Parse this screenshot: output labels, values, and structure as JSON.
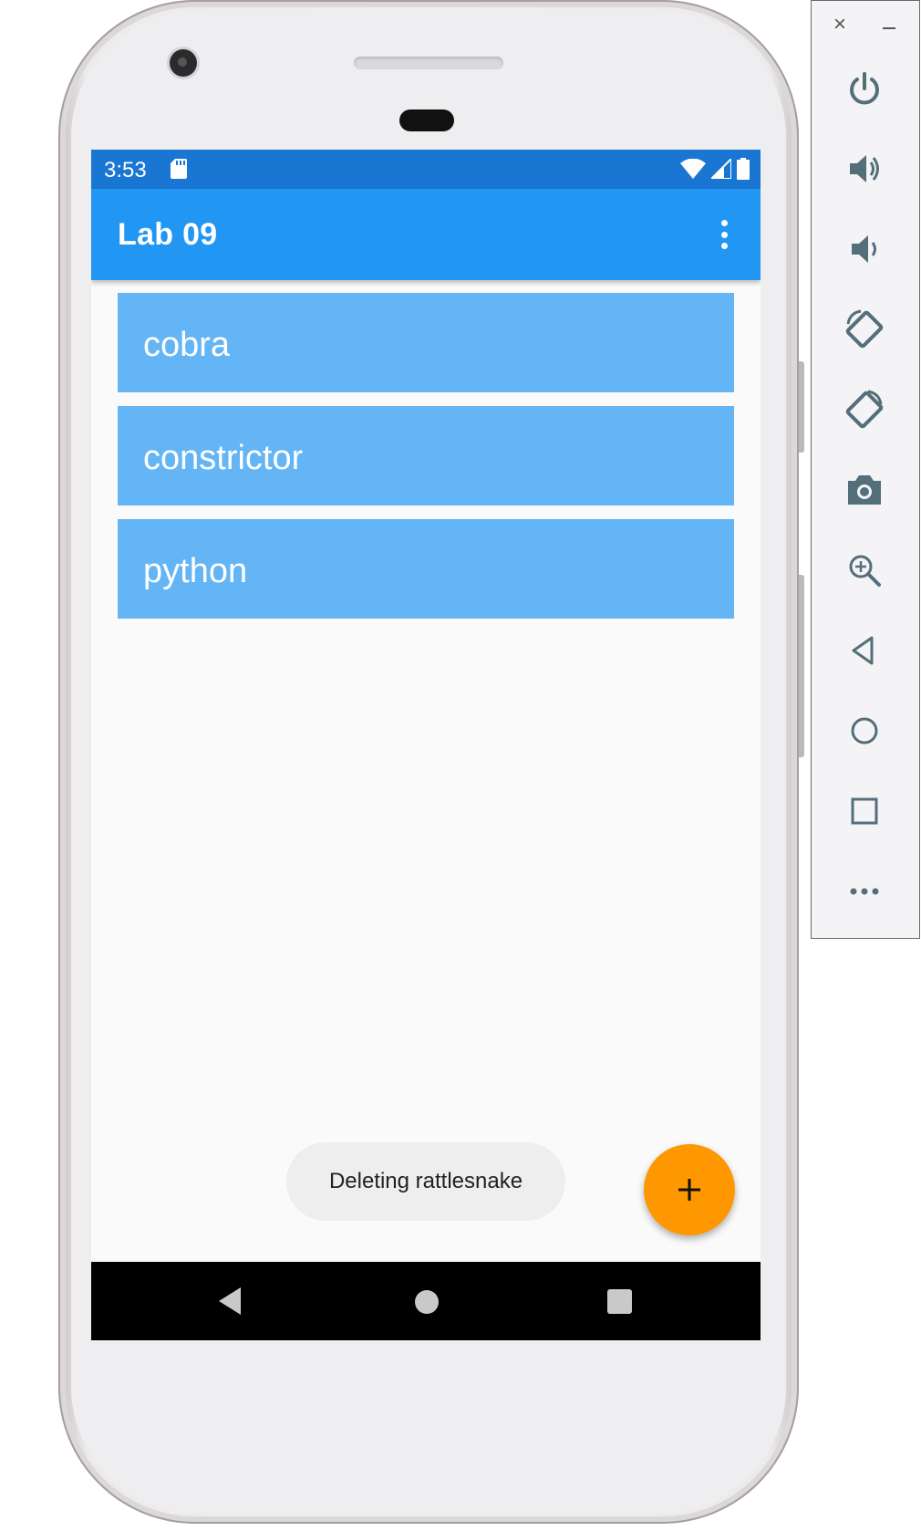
{
  "status_bar": {
    "time": "3:53"
  },
  "app_bar": {
    "title": "Lab 09"
  },
  "list": {
    "items": [
      {
        "label": "cobra"
      },
      {
        "label": "constrictor"
      },
      {
        "label": "python"
      }
    ]
  },
  "toast": {
    "message": "Deleting rattlesnake"
  },
  "fab": {
    "icon": "plus-icon"
  },
  "emulator_toolbar": {
    "buttons": [
      "power",
      "volume-up",
      "volume-down",
      "rotate-left",
      "rotate-right",
      "screenshot",
      "zoom",
      "back",
      "home",
      "overview",
      "more"
    ]
  },
  "colors": {
    "status_bar": "#1976d2",
    "app_bar": "#2196f3",
    "list_item": "#64b5f6",
    "fab": "#ff9800",
    "toolbar_icon": "#546e7a"
  }
}
